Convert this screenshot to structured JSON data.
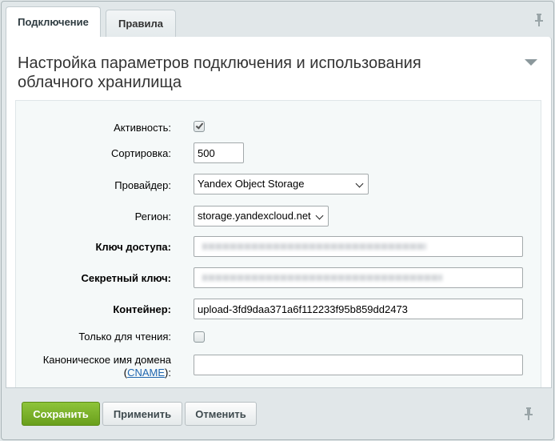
{
  "tabs": [
    {
      "label": "Подключение",
      "active": true
    },
    {
      "label": "Правила",
      "active": false
    }
  ],
  "section": {
    "heading": "Настройка параметров подключения и использования облачного хранилища"
  },
  "form": {
    "active_label": "Активность:",
    "active_checked": true,
    "sort_label": "Сортировка:",
    "sort_value": "500",
    "provider_label": "Провайдер:",
    "provider_value": "Yandex Object Storage",
    "region_label": "Регион:",
    "region_value": "storage.yandexcloud.net",
    "access_key_label": "Ключ доступа:",
    "secret_key_label": "Секретный ключ:",
    "container_label": "Контейнер:",
    "container_value": "upload-3fd9daa371a6f112233f95b859dd2473",
    "readonly_label": "Только для чтения:",
    "readonly_checked": false,
    "cname_label_prefix": "Каноническое имя домена",
    "cname_link": "CNAME",
    "cname_open": "(",
    "cname_close": "):",
    "cname_value": ""
  },
  "buttons": {
    "save": "Сохранить",
    "apply": "Применить",
    "cancel": "Отменить"
  },
  "icons": [
    "pin-icon",
    "collapse-arrow-icon",
    "checkmark-icon",
    "chevron-down-icon"
  ]
}
